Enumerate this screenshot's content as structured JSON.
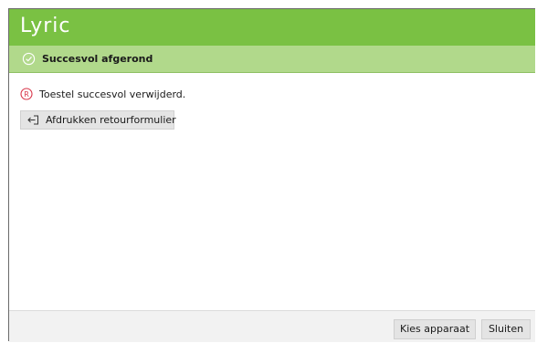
{
  "app": {
    "logo_text": "Lyric",
    "brand_color": "#7ac143"
  },
  "status": {
    "icon": "check-circle-icon",
    "text": "Succesvol afgerond",
    "color": "#b1d98b"
  },
  "message": {
    "icon": "registered-r-icon",
    "text": "Toestel succesvol verwijderd."
  },
  "actions": {
    "print_icon": "return-arrow-icon",
    "print_label": "Afdrukken retourformulier"
  },
  "footer": {
    "choose_device_label": "Kies apparaat",
    "close_label": "Sluiten"
  }
}
